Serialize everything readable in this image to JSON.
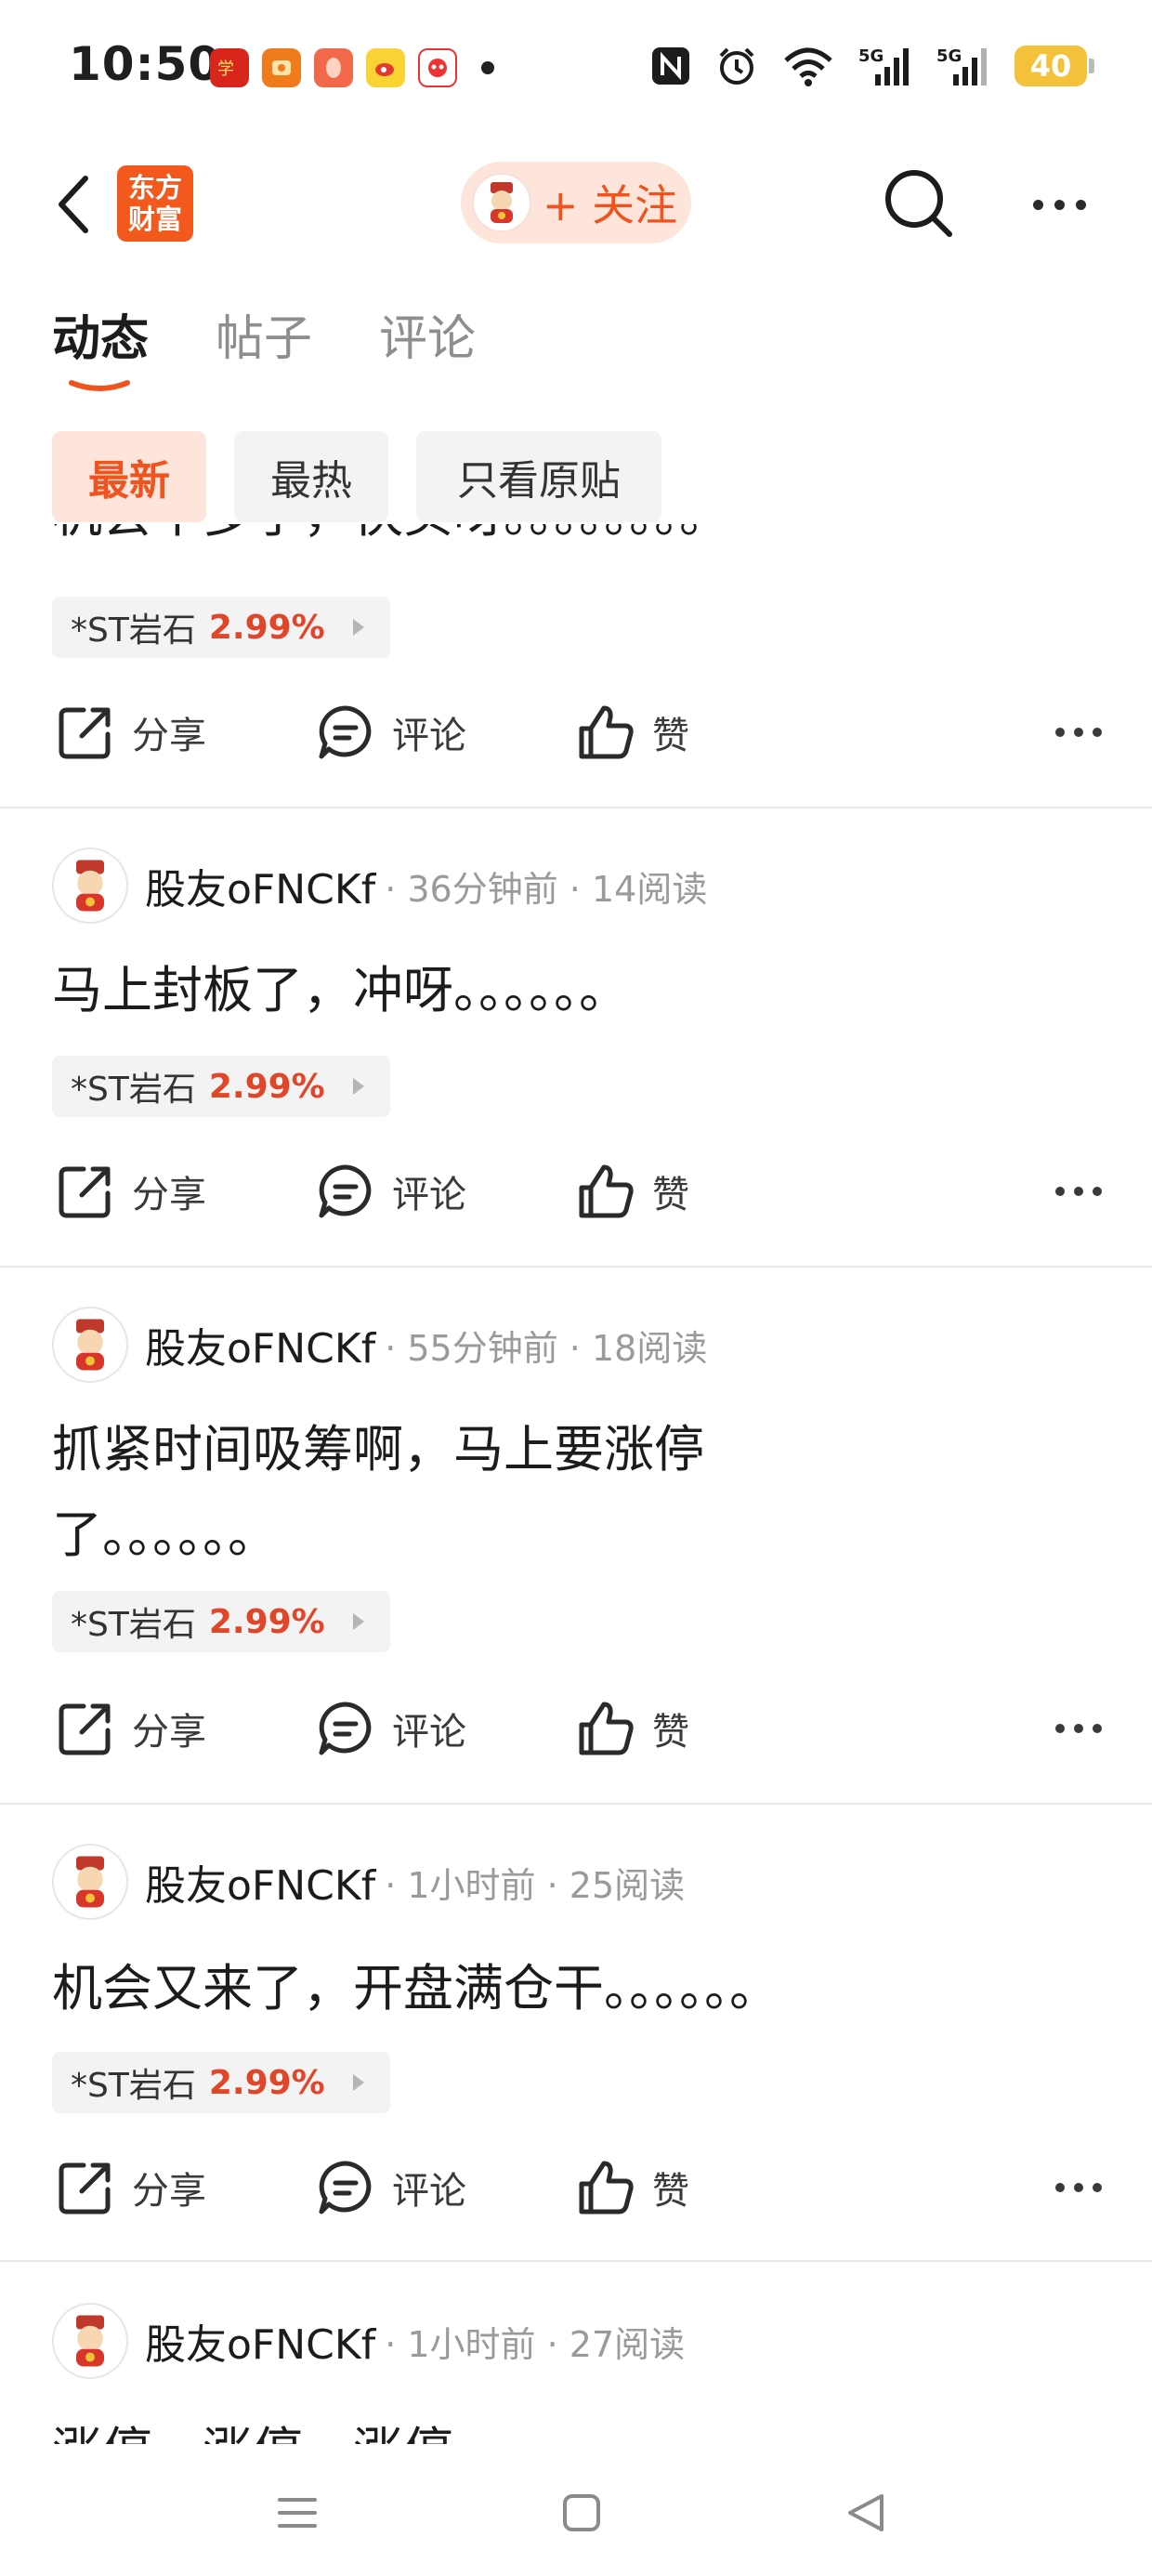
{
  "status_bar": {
    "time": "10:50",
    "battery": "40",
    "notification_icons": [
      "xuexi-icon",
      "app-orange-icon",
      "app-peach-icon",
      "weibo-icon",
      "app-red-face-icon"
    ]
  },
  "header": {
    "logo_line1": "东方",
    "logo_line2": "财富",
    "follow_label": "+ 关注"
  },
  "tabs": [
    {
      "label": "动态",
      "active": true
    },
    {
      "label": "帖子",
      "active": false
    },
    {
      "label": "评论",
      "active": false
    }
  ],
  "filters": [
    {
      "label": "最新",
      "active": true
    },
    {
      "label": "最热",
      "active": false
    },
    {
      "label": "只看原贴",
      "active": false
    }
  ],
  "actions": {
    "share": "分享",
    "comment": "评论",
    "like": "赞"
  },
  "partial_top_post": {
    "text": "机会不多了，快买呀。。。。。。。。",
    "stock_name": "*ST岩石",
    "stock_change": "2.99%"
  },
  "posts": [
    {
      "author": "股友oFNCKf",
      "meta": "· 36分钟前 · 14阅读",
      "text": "马上封板了，冲呀。。。。。。",
      "stock_name": "*ST岩石",
      "stock_change": "2.99%"
    },
    {
      "author": "股友oFNCKf",
      "meta": "· 55分钟前 · 18阅读",
      "text": "抓紧时间吸筹啊，马上要涨停了。。。。。。",
      "stock_name": "*ST岩石",
      "stock_change": "2.99%"
    },
    {
      "author": "股友oFNCKf",
      "meta": "· 1小时前 · 25阅读",
      "text": "机会又来了，开盘满仓干。。。。。。",
      "stock_name": "*ST岩石",
      "stock_change": "2.99%"
    },
    {
      "author": "股友oFNCKf",
      "meta": "· 1小时前 · 27阅读",
      "text": "涨停，涨停，涨停"
    }
  ],
  "colors": {
    "accent": "#f0541e",
    "accent_bg": "#fde5dc",
    "stock_red": "#e0462a"
  }
}
